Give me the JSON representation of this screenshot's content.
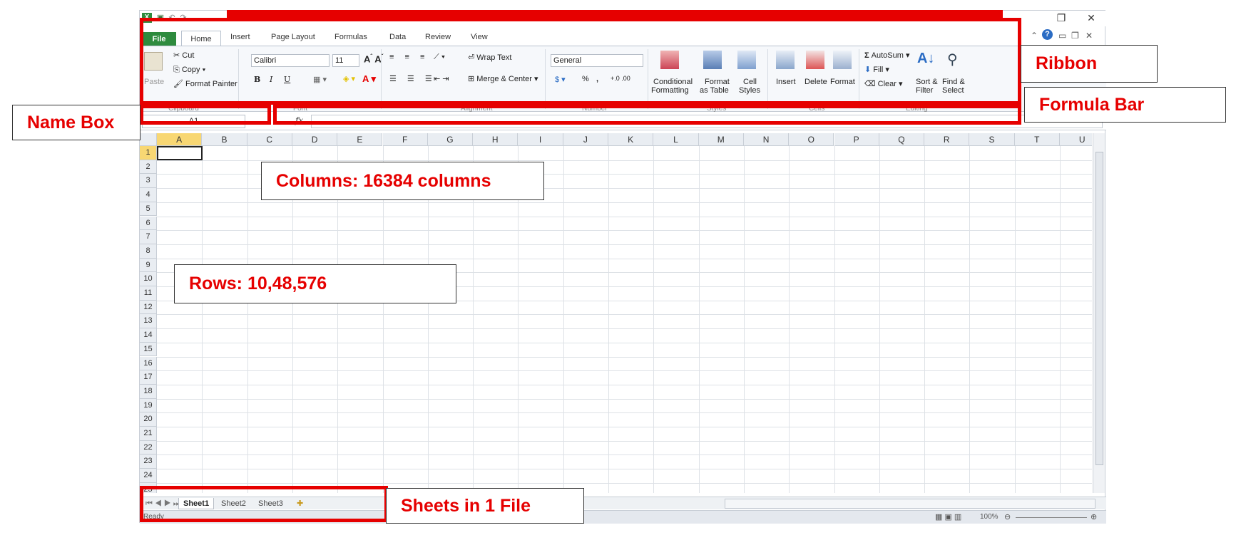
{
  "excel": {
    "name_box_value": "A1",
    "fx_label": "fx",
    "tabs": [
      "File",
      "Home",
      "Insert",
      "Page Layout",
      "Formulas",
      "Data",
      "Review",
      "View"
    ],
    "clipboard": {
      "paste": "Paste",
      "cut": "Cut",
      "copy": "Copy",
      "format_painter": "Format Painter",
      "group": "Clipboard"
    },
    "font": {
      "name": "Calibri",
      "size": "11",
      "bold": "B",
      "italic": "I",
      "underline": "U",
      "group": "Font"
    },
    "alignment": {
      "wrap_text": "Wrap Text",
      "merge_center": "Merge & Center",
      "group": "Alignment"
    },
    "number": {
      "format": "General",
      "percent": "%",
      "comma": ",",
      "group": "Number"
    },
    "styles": {
      "conditional": "Conditional",
      "conditional2": "Formatting",
      "format_table": "Format",
      "format_table2": "as Table",
      "cell_styles": "Cell",
      "cell_styles2": "Styles",
      "group": "Styles"
    },
    "cells": {
      "insert": "Insert",
      "delete": "Delete",
      "format": "Format",
      "group": "Cells"
    },
    "editing": {
      "autosum": "AutoSum",
      "fill": "Fill",
      "clear": "Clear",
      "sort": "Sort &",
      "sort2": "Filter",
      "find": "Find &",
      "find2": "Select",
      "group": "Editing"
    },
    "columns": [
      "A",
      "B",
      "C",
      "D",
      "E",
      "F",
      "G",
      "H",
      "I",
      "J",
      "K",
      "L",
      "M",
      "N",
      "O",
      "P",
      "Q",
      "R",
      "S",
      "T",
      "U"
    ],
    "rows": [
      "1",
      "2",
      "3",
      "4",
      "5",
      "6",
      "7",
      "8",
      "9",
      "10",
      "11",
      "12",
      "13",
      "14",
      "15",
      "16",
      "17",
      "18",
      "19",
      "20",
      "21",
      "22",
      "23",
      "24",
      "25"
    ],
    "sheets": [
      "Sheet1",
      "Sheet2",
      "Sheet3"
    ],
    "status_ready": "Ready",
    "zoom": "100%"
  },
  "annotations": {
    "ribbon": "Ribbon",
    "formula_bar": "Formula Bar",
    "name_box": "Name Box",
    "columns": "Columns: 16384 columns",
    "rows": "Rows: 10,48,576",
    "sheets": "Sheets in 1 File"
  },
  "colors": {
    "annotation_red": "#e60000",
    "file_tab_green": "#2e8b3e",
    "selected_header": "#f8d773"
  }
}
